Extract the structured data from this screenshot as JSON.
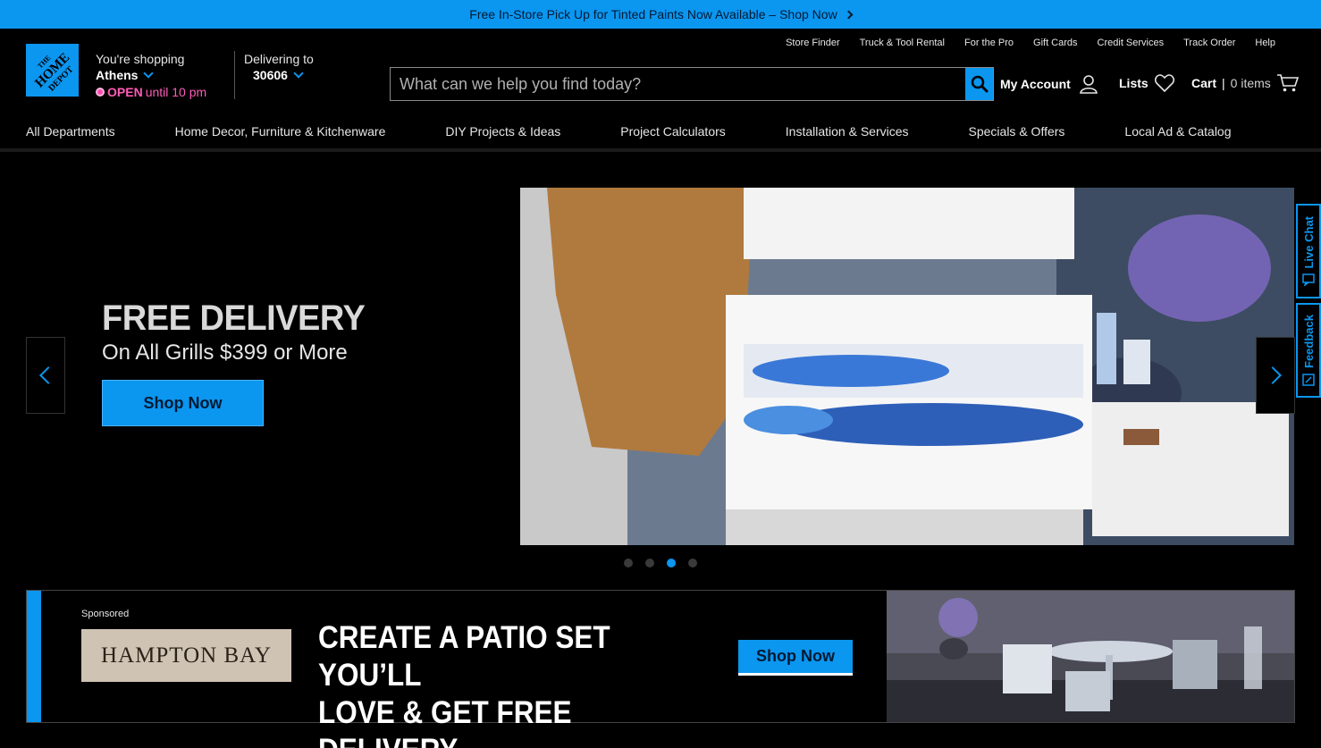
{
  "promo": {
    "text": "Free In-Store Pick Up for Tinted Paints Now Available – Shop Now"
  },
  "brand": {
    "logo_text": "THE HOME DEPOT"
  },
  "store": {
    "shopping_label": "You're shopping",
    "city": "Athens",
    "open_label": "OPEN",
    "hours": "until 10 pm"
  },
  "delivery": {
    "label": "Delivering to",
    "zip": "30606"
  },
  "util_links": [
    "Store Finder",
    "Truck & Tool Rental",
    "For the Pro",
    "Gift Cards",
    "Credit Services",
    "Track Order",
    "Help"
  ],
  "search": {
    "placeholder": "What can we help you find today?"
  },
  "header": {
    "account_label": "My Account",
    "lists_label": "Lists",
    "cart_label": "Cart",
    "cart_divider": "|",
    "cart_count": "0 items"
  },
  "nav": [
    "All Departments",
    "Home Decor, Furniture & Kitchenware",
    "DIY Projects & Ideas",
    "Project Calculators",
    "Installation & Services",
    "Specials & Offers",
    "Local Ad & Catalog"
  ],
  "hero": {
    "title": "FREE DELIVERY",
    "subtitle": "On All Grills $399 or More",
    "button": "Shop Now",
    "active_slide": 3,
    "slide_count": 4
  },
  "side_tabs": {
    "live_chat": "Live Chat",
    "feedback": "Feedback"
  },
  "banner": {
    "sponsored": "Sponsored",
    "brand": "HAMPTON BAY",
    "headline_line1": "CREATE A PATIO SET YOU’LL",
    "headline_line2": "LOVE & GET FREE DELIVERY",
    "button": "Shop Now"
  },
  "colors": {
    "accent": "#0b96f0",
    "open_status": "#ff5cb8",
    "background": "#000000"
  }
}
